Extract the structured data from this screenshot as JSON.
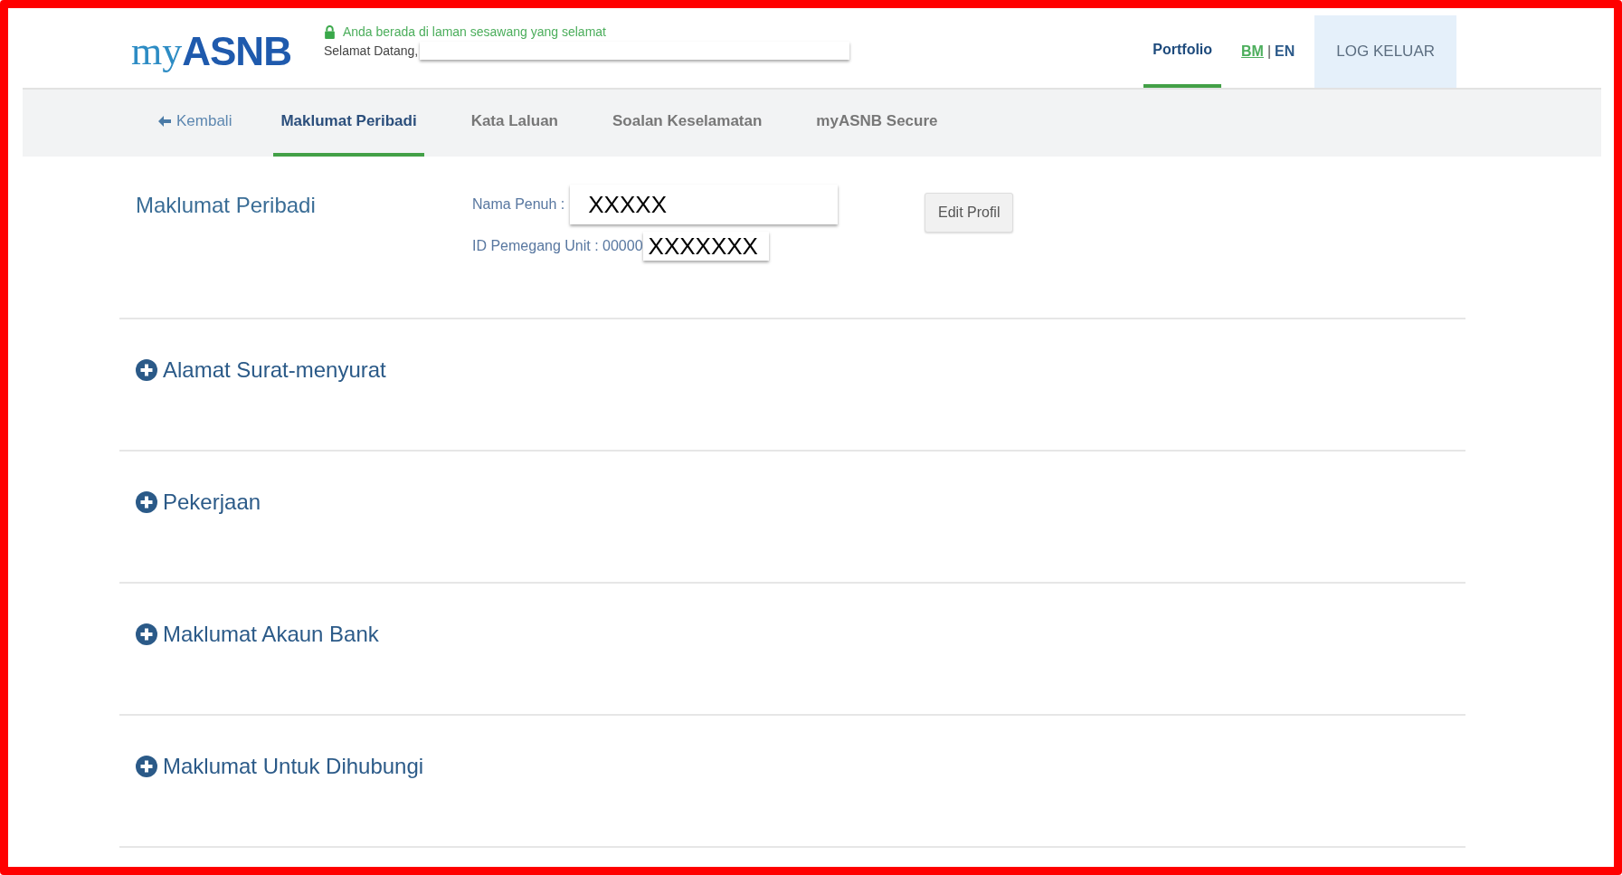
{
  "header": {
    "logo": {
      "prefix": "my",
      "name": "ASNB"
    },
    "secure_note": "Anda berada di laman sesawang yang selamat",
    "welcome": "Selamat Datang,",
    "nav": [
      {
        "label": "Portfolio",
        "selected": true
      },
      {
        "kind": "lang",
        "label": "BM",
        "separator": "|",
        "other": "EN"
      },
      {
        "kind": "logout",
        "label": "LOG KELUAR"
      }
    ]
  },
  "tabs": [
    {
      "label": "Kembali",
      "kind": "back",
      "selected": false
    },
    {
      "label": "Maklumat Peribadi",
      "selected": true
    },
    {
      "label": "Kata Laluan",
      "selected": false
    },
    {
      "label": "Soalan Keselamatan",
      "selected": false
    },
    {
      "label": "myASNB Secure",
      "selected": false
    }
  ],
  "profile": {
    "heading": "Maklumat Peribadi",
    "fields": [
      {
        "label": "Nama Penuh :",
        "value": "XXXXX",
        "kind": "wide"
      },
      {
        "label": "ID Pemegang Unit : 00000",
        "value": "XXXXXXX",
        "kind": "narrow"
      }
    ],
    "button": "Edit Profil"
  },
  "sections": [
    {
      "title": "Alamat Surat-menyurat",
      "expanded": false
    },
    {
      "title": "Pekerjaan",
      "expanded": false
    },
    {
      "title": "Maklumat Akaun Bank",
      "expanded": false
    },
    {
      "title": "Maklumat Untuk Dihubungi",
      "expanded": false
    }
  ]
}
